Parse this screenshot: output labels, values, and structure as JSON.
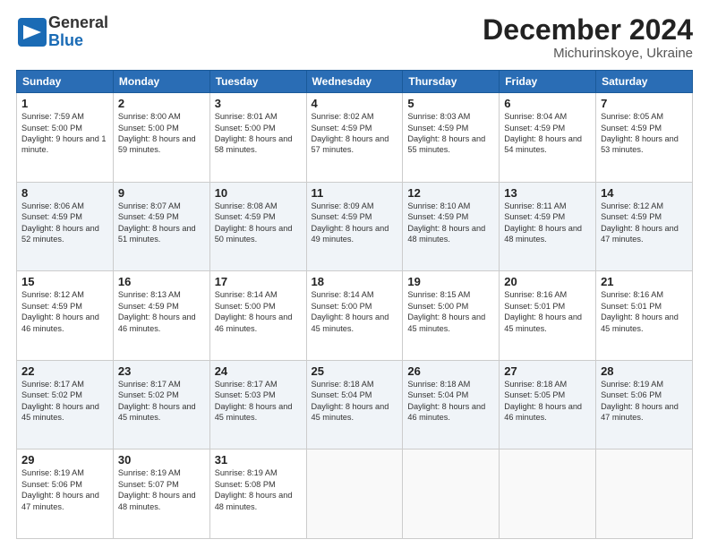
{
  "header": {
    "logo": {
      "line1": "General",
      "line2": "Blue"
    },
    "title": "December 2024",
    "location": "Michurinskoye, Ukraine"
  },
  "days_of_week": [
    "Sunday",
    "Monday",
    "Tuesday",
    "Wednesday",
    "Thursday",
    "Friday",
    "Saturday"
  ],
  "weeks": [
    [
      {
        "day": "1",
        "sunrise": "Sunrise: 7:59 AM",
        "sunset": "Sunset: 5:00 PM",
        "daylight": "Daylight: 9 hours and 1 minute."
      },
      {
        "day": "2",
        "sunrise": "Sunrise: 8:00 AM",
        "sunset": "Sunset: 5:00 PM",
        "daylight": "Daylight: 8 hours and 59 minutes."
      },
      {
        "day": "3",
        "sunrise": "Sunrise: 8:01 AM",
        "sunset": "Sunset: 5:00 PM",
        "daylight": "Daylight: 8 hours and 58 minutes."
      },
      {
        "day": "4",
        "sunrise": "Sunrise: 8:02 AM",
        "sunset": "Sunset: 4:59 PM",
        "daylight": "Daylight: 8 hours and 57 minutes."
      },
      {
        "day": "5",
        "sunrise": "Sunrise: 8:03 AM",
        "sunset": "Sunset: 4:59 PM",
        "daylight": "Daylight: 8 hours and 55 minutes."
      },
      {
        "day": "6",
        "sunrise": "Sunrise: 8:04 AM",
        "sunset": "Sunset: 4:59 PM",
        "daylight": "Daylight: 8 hours and 54 minutes."
      },
      {
        "day": "7",
        "sunrise": "Sunrise: 8:05 AM",
        "sunset": "Sunset: 4:59 PM",
        "daylight": "Daylight: 8 hours and 53 minutes."
      }
    ],
    [
      {
        "day": "8",
        "sunrise": "Sunrise: 8:06 AM",
        "sunset": "Sunset: 4:59 PM",
        "daylight": "Daylight: 8 hours and 52 minutes."
      },
      {
        "day": "9",
        "sunrise": "Sunrise: 8:07 AM",
        "sunset": "Sunset: 4:59 PM",
        "daylight": "Daylight: 8 hours and 51 minutes."
      },
      {
        "day": "10",
        "sunrise": "Sunrise: 8:08 AM",
        "sunset": "Sunset: 4:59 PM",
        "daylight": "Daylight: 8 hours and 50 minutes."
      },
      {
        "day": "11",
        "sunrise": "Sunrise: 8:09 AM",
        "sunset": "Sunset: 4:59 PM",
        "daylight": "Daylight: 8 hours and 49 minutes."
      },
      {
        "day": "12",
        "sunrise": "Sunrise: 8:10 AM",
        "sunset": "Sunset: 4:59 PM",
        "daylight": "Daylight: 8 hours and 48 minutes."
      },
      {
        "day": "13",
        "sunrise": "Sunrise: 8:11 AM",
        "sunset": "Sunset: 4:59 PM",
        "daylight": "Daylight: 8 hours and 48 minutes."
      },
      {
        "day": "14",
        "sunrise": "Sunrise: 8:12 AM",
        "sunset": "Sunset: 4:59 PM",
        "daylight": "Daylight: 8 hours and 47 minutes."
      }
    ],
    [
      {
        "day": "15",
        "sunrise": "Sunrise: 8:12 AM",
        "sunset": "Sunset: 4:59 PM",
        "daylight": "Daylight: 8 hours and 46 minutes."
      },
      {
        "day": "16",
        "sunrise": "Sunrise: 8:13 AM",
        "sunset": "Sunset: 4:59 PM",
        "daylight": "Daylight: 8 hours and 46 minutes."
      },
      {
        "day": "17",
        "sunrise": "Sunrise: 8:14 AM",
        "sunset": "Sunset: 5:00 PM",
        "daylight": "Daylight: 8 hours and 46 minutes."
      },
      {
        "day": "18",
        "sunrise": "Sunrise: 8:14 AM",
        "sunset": "Sunset: 5:00 PM",
        "daylight": "Daylight: 8 hours and 45 minutes."
      },
      {
        "day": "19",
        "sunrise": "Sunrise: 8:15 AM",
        "sunset": "Sunset: 5:00 PM",
        "daylight": "Daylight: 8 hours and 45 minutes."
      },
      {
        "day": "20",
        "sunrise": "Sunrise: 8:16 AM",
        "sunset": "Sunset: 5:01 PM",
        "daylight": "Daylight: 8 hours and 45 minutes."
      },
      {
        "day": "21",
        "sunrise": "Sunrise: 8:16 AM",
        "sunset": "Sunset: 5:01 PM",
        "daylight": "Daylight: 8 hours and 45 minutes."
      }
    ],
    [
      {
        "day": "22",
        "sunrise": "Sunrise: 8:17 AM",
        "sunset": "Sunset: 5:02 PM",
        "daylight": "Daylight: 8 hours and 45 minutes."
      },
      {
        "day": "23",
        "sunrise": "Sunrise: 8:17 AM",
        "sunset": "Sunset: 5:02 PM",
        "daylight": "Daylight: 8 hours and 45 minutes."
      },
      {
        "day": "24",
        "sunrise": "Sunrise: 8:17 AM",
        "sunset": "Sunset: 5:03 PM",
        "daylight": "Daylight: 8 hours and 45 minutes."
      },
      {
        "day": "25",
        "sunrise": "Sunrise: 8:18 AM",
        "sunset": "Sunset: 5:04 PM",
        "daylight": "Daylight: 8 hours and 45 minutes."
      },
      {
        "day": "26",
        "sunrise": "Sunrise: 8:18 AM",
        "sunset": "Sunset: 5:04 PM",
        "daylight": "Daylight: 8 hours and 46 minutes."
      },
      {
        "day": "27",
        "sunrise": "Sunrise: 8:18 AM",
        "sunset": "Sunset: 5:05 PM",
        "daylight": "Daylight: 8 hours and 46 minutes."
      },
      {
        "day": "28",
        "sunrise": "Sunrise: 8:19 AM",
        "sunset": "Sunset: 5:06 PM",
        "daylight": "Daylight: 8 hours and 47 minutes."
      }
    ],
    [
      {
        "day": "29",
        "sunrise": "Sunrise: 8:19 AM",
        "sunset": "Sunset: 5:06 PM",
        "daylight": "Daylight: 8 hours and 47 minutes."
      },
      {
        "day": "30",
        "sunrise": "Sunrise: 8:19 AM",
        "sunset": "Sunset: 5:07 PM",
        "daylight": "Daylight: 8 hours and 48 minutes."
      },
      {
        "day": "31",
        "sunrise": "Sunrise: 8:19 AM",
        "sunset": "Sunset: 5:08 PM",
        "daylight": "Daylight: 8 hours and 48 minutes."
      },
      null,
      null,
      null,
      null
    ]
  ]
}
